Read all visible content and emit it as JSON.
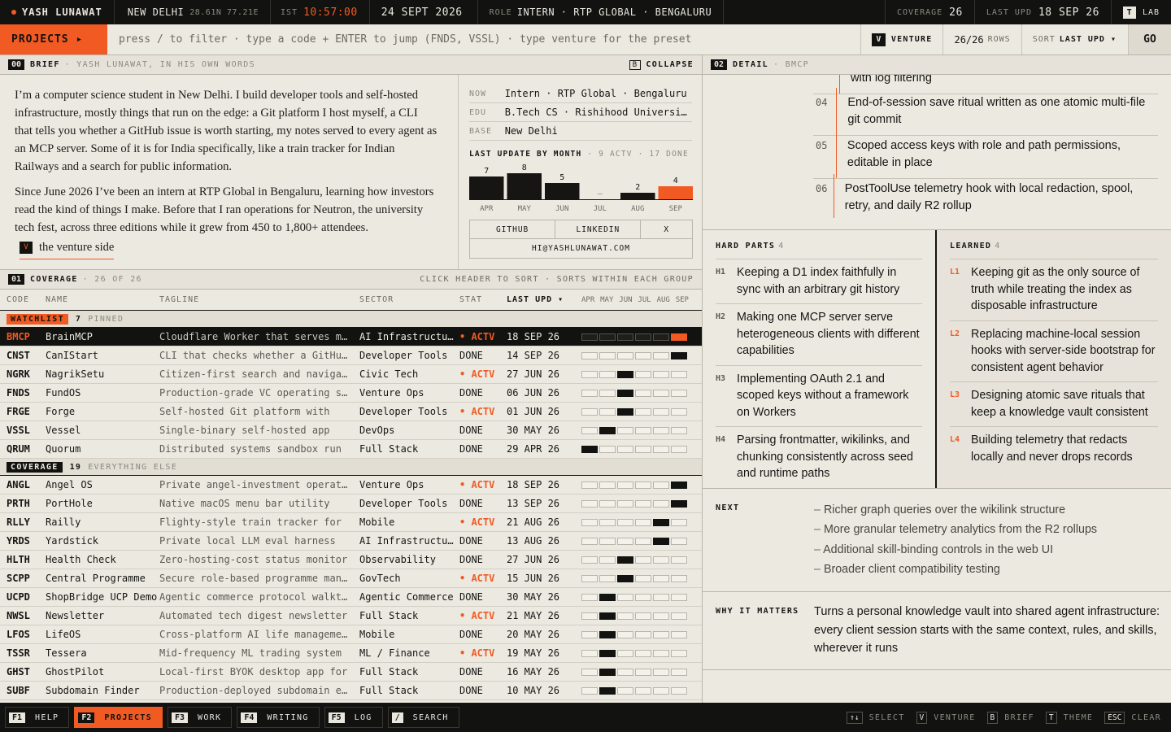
{
  "topbar": {
    "name": "YASH LUNAWAT",
    "city": "NEW DELHI",
    "coords": "28.61N 77.21E",
    "tz": "IST",
    "time": "10:57:00",
    "date": "24 SEPT 2026",
    "role_label": "ROLE",
    "role": "INTERN · RTP GLOBAL · BENGALURU",
    "coverage_label": "COVERAGE",
    "coverage": "26",
    "last_upd_label": "LAST UPD",
    "last_upd": "18 SEP 26",
    "theme_key": "T",
    "theme_label": "LAB"
  },
  "cmdbar": {
    "projects": "PROJECTS ▸",
    "hint": "press / to filter · type a code + ENTER to jump (FNDS, VSSL) · type venture for the preset",
    "venture_key": "V",
    "venture": "VENTURE",
    "rows": "26/26",
    "rows_label": "ROWS",
    "sort_label": "SORT",
    "sort_value": "LAST UPD ▾",
    "go": "GO"
  },
  "brief": {
    "num": "00",
    "title": "BRIEF",
    "subtitle": "· YASH LUNAWAT, IN HIS OWN WORDS",
    "collapse_key": "B",
    "collapse": "COLLAPSE",
    "p1": "I’m a computer science student in New Delhi. I build developer tools and self-hosted infrastructure, mostly things that run on the edge: a Git platform I host myself, a CLI that tells you whether a GitHub issue is worth starting, my notes served to every agent as an MCP server. Some of it is for India specifically, like a train tracker for Indian Railways and a search for public information.",
    "p2": "Since June 2026 I’ve been an intern at RTP Global in Bengaluru, learning how investors read the kind of things I make. Before that I ran operations for Neutron, the university tech fest, across three editions while it grew from 450 to 1,800+ attendees.",
    "venture_key": "V",
    "venture_link": "the venture side",
    "now_label": "NOW",
    "now": "Intern · RTP Global · Bengaluru",
    "edu_label": "EDU",
    "edu": "B.Tech CS · Rishihood University",
    "base_label": "BASE",
    "base": "New Delhi",
    "chart_title": "LAST UPDATE BY MONTH",
    "chart_sub": "· 9 ACTV · 17 DONE",
    "links": {
      "github": "GITHUB",
      "linkedin": "LINKEDIN",
      "x": "X",
      "email": "HI@YASHLUNAWAT.COM"
    }
  },
  "chart_data": {
    "type": "bar",
    "title": "LAST UPDATE BY MONTH",
    "categories": [
      "APR",
      "MAY",
      "JUN",
      "JUL",
      "AUG",
      "SEP"
    ],
    "values": [
      7,
      8,
      5,
      0,
      2,
      4
    ],
    "value_labels": [
      "7",
      "8",
      "5",
      "–",
      "2",
      "4"
    ],
    "highlight": "SEP",
    "colors": {
      "bar": "#161513",
      "highlight": "#f15a22"
    }
  },
  "coverage": {
    "num": "01",
    "title": "COVERAGE",
    "subtitle": "· 26 OF 26",
    "right": "CLICK HEADER TO SORT · SORTS WITHIN EACH GROUP",
    "headers": {
      "code": "CODE",
      "name": "NAME",
      "tagline": "TAGLINE",
      "sector": "SECTOR",
      "stat": "STAT",
      "upd": "LAST UPD ▾"
    },
    "months": [
      "APR",
      "MAY",
      "JUN",
      "JUL",
      "AUG",
      "SEP"
    ],
    "groups": [
      {
        "badge": "WATCHLIST",
        "count": "7",
        "sub": "PINNED",
        "badge_bg": "#f15a22",
        "badge_fg": "#121210",
        "rows": [
          {
            "code": "BMCP",
            "name": "BrainMCP",
            "tagline": "Cloudflare Worker that serves my Obsidian vault",
            "sector": "AI Infrastructure",
            "stat": "ACTV",
            "upd": "18 SEP 26",
            "month": 5,
            "selected": true
          },
          {
            "code": "CNST",
            "name": "CanIStart",
            "tagline": "CLI that checks whether a GitHub issue is worth starting",
            "sector": "Developer Tools",
            "stat": "DONE",
            "upd": "14 SEP 26",
            "month": 5
          },
          {
            "code": "NGRK",
            "name": "NagrikSetu",
            "tagline": "Citizen-first search and navigation",
            "sector": "Civic Tech",
            "stat": "ACTV",
            "upd": "27 JUN 26",
            "month": 2
          },
          {
            "code": "FNDS",
            "name": "FundOS",
            "tagline": "Production-grade VC operating system",
            "sector": "Venture Ops",
            "stat": "DONE",
            "upd": "06 JUN 26",
            "month": 2
          },
          {
            "code": "FRGE",
            "name": "Forge",
            "tagline": "Self-hosted Git platform with",
            "sector": "Developer Tools",
            "stat": "ACTV",
            "upd": "01 JUN 26",
            "month": 2
          },
          {
            "code": "VSSL",
            "name": "Vessel",
            "tagline": "Single-binary self-hosted app",
            "sector": "DevOps",
            "stat": "DONE",
            "upd": "30 MAY 26",
            "month": 1
          },
          {
            "code": "QRUM",
            "name": "Quorum",
            "tagline": "Distributed systems sandbox run",
            "sector": "Full Stack",
            "stat": "DONE",
            "upd": "29 APR 26",
            "month": 0
          }
        ]
      },
      {
        "badge": "COVERAGE",
        "count": "19",
        "sub": "EVERYTHING ELSE",
        "badge_bg": "#121210",
        "badge_fg": "#ece9e1",
        "rows": [
          {
            "code": "ANGL",
            "name": "Angel OS",
            "tagline": "Private angel-investment operating",
            "sector": "Venture Ops",
            "stat": "ACTV",
            "upd": "18 SEP 26",
            "month": 5
          },
          {
            "code": "PRTH",
            "name": "PortHole",
            "tagline": "Native macOS menu bar utility",
            "sector": "Developer Tools",
            "stat": "DONE",
            "upd": "13 SEP 26",
            "month": 5
          },
          {
            "code": "RLLY",
            "name": "Railly",
            "tagline": "Flighty-style train tracker for",
            "sector": "Mobile",
            "stat": "ACTV",
            "upd": "21 AUG 26",
            "month": 4
          },
          {
            "code": "YRDS",
            "name": "Yardstick",
            "tagline": "Private local LLM eval harness",
            "sector": "AI Infrastructure",
            "stat": "DONE",
            "upd": "13 AUG 26",
            "month": 4
          },
          {
            "code": "HLTH",
            "name": "Health Check",
            "tagline": "Zero-hosting-cost status monitor",
            "sector": "Observability",
            "stat": "DONE",
            "upd": "27 JUN 26",
            "month": 2
          },
          {
            "code": "SCPP",
            "name": "Central Programme",
            "tagline": "Secure role-based programme management",
            "sector": "GovTech",
            "stat": "ACTV",
            "upd": "15 JUN 26",
            "month": 2
          },
          {
            "code": "UCPD",
            "name": "ShopBridge UCP Demo",
            "tagline": "Agentic commerce protocol walkthrough",
            "sector": "Agentic Commerce",
            "stat": "DONE",
            "upd": "30 MAY 26",
            "month": 1
          },
          {
            "code": "NWSL",
            "name": "Newsletter",
            "tagline": "Automated tech digest newsletter",
            "sector": "Full Stack",
            "stat": "ACTV",
            "upd": "21 MAY 26",
            "month": 1
          },
          {
            "code": "LFOS",
            "name": "LifeOS",
            "tagline": "Cross-platform AI life management",
            "sector": "Mobile",
            "stat": "DONE",
            "upd": "20 MAY 26",
            "month": 1
          },
          {
            "code": "TSSR",
            "name": "Tessera",
            "tagline": "Mid-frequency ML trading system",
            "sector": "ML / Finance",
            "stat": "ACTV",
            "upd": "19 MAY 26",
            "month": 1
          },
          {
            "code": "GHST",
            "name": "GhostPilot",
            "tagline": "Local-first BYOK desktop app for",
            "sector": "Full Stack",
            "stat": "DONE",
            "upd": "16 MAY 26",
            "month": 1
          },
          {
            "code": "SUBF",
            "name": "Subdomain Finder",
            "tagline": "Production-deployed subdomain enumeration",
            "sector": "Full Stack",
            "stat": "DONE",
            "upd": "10 MAY 26",
            "month": 1
          }
        ]
      }
    ]
  },
  "detail": {
    "num": "02",
    "title": "DETAIL",
    "subtitle": "· BMCP",
    "steps": [
      {
        "n": "",
        "text": "with log filtering"
      },
      {
        "n": "04",
        "text": "End-of-session save ritual written as one atomic multi-file git commit"
      },
      {
        "n": "05",
        "text": "Scoped access keys with role and path permissions, editable in place"
      },
      {
        "n": "06",
        "text": "PostToolUse telemetry hook with local redaction, spool, retry, and daily R2 rollup"
      }
    ],
    "hard_title": "HARD PARTS",
    "hard_count": "4",
    "hard": [
      {
        "n": "H1",
        "text": "Keeping a D1 index faithfully in sync with an arbitrary git history"
      },
      {
        "n": "H2",
        "text": "Making one MCP server serve heterogeneous clients with different capabilities"
      },
      {
        "n": "H3",
        "text": "Implementing OAuth 2.1 and scoped keys without a framework on Workers"
      },
      {
        "n": "H4",
        "text": "Parsing frontmatter, wikilinks, and chunking consistently across seed and runtime paths"
      }
    ],
    "learned_title": "LEARNED",
    "learned_count": "4",
    "learned": [
      {
        "n": "L1",
        "text": "Keeping git as the only source of truth while treating the index as disposable infrastructure"
      },
      {
        "n": "L2",
        "text": "Replacing machine-local session hooks with server-side bootstrap for consistent agent behavior"
      },
      {
        "n": "L3",
        "text": "Designing atomic save rituals that keep a knowledge vault consistent"
      },
      {
        "n": "L4",
        "text": "Building telemetry that redacts locally and never drops records"
      }
    ],
    "next_label": "NEXT",
    "next": [
      "Richer graph queries over the wikilink structure",
      "More granular telemetry analytics from the R2 rollups",
      "Additional skill-binding controls in the web UI",
      "Broader client compatibility testing"
    ],
    "why_label": "WHY IT MATTERS",
    "why": "Turns a personal knowledge vault into shared agent infrastructure: every client session starts with the same context, rules, and skills, wherever it runs"
  },
  "footer": {
    "keys": [
      {
        "k": "F1",
        "label": "HELP"
      },
      {
        "k": "F2",
        "label": "PROJECTS",
        "active": true
      },
      {
        "k": "F3",
        "label": "WORK"
      },
      {
        "k": "F4",
        "label": "WRITING"
      },
      {
        "k": "F5",
        "label": "LOG"
      },
      {
        "k": "/",
        "label": "SEARCH"
      }
    ],
    "shortcuts": [
      {
        "k": "↑↓",
        "label": "SELECT"
      },
      {
        "k": "V",
        "label": "VENTURE"
      },
      {
        "k": "B",
        "label": "BRIEF"
      },
      {
        "k": "T",
        "label": "THEME"
      },
      {
        "k": "ESC",
        "label": "CLEAR"
      }
    ]
  }
}
